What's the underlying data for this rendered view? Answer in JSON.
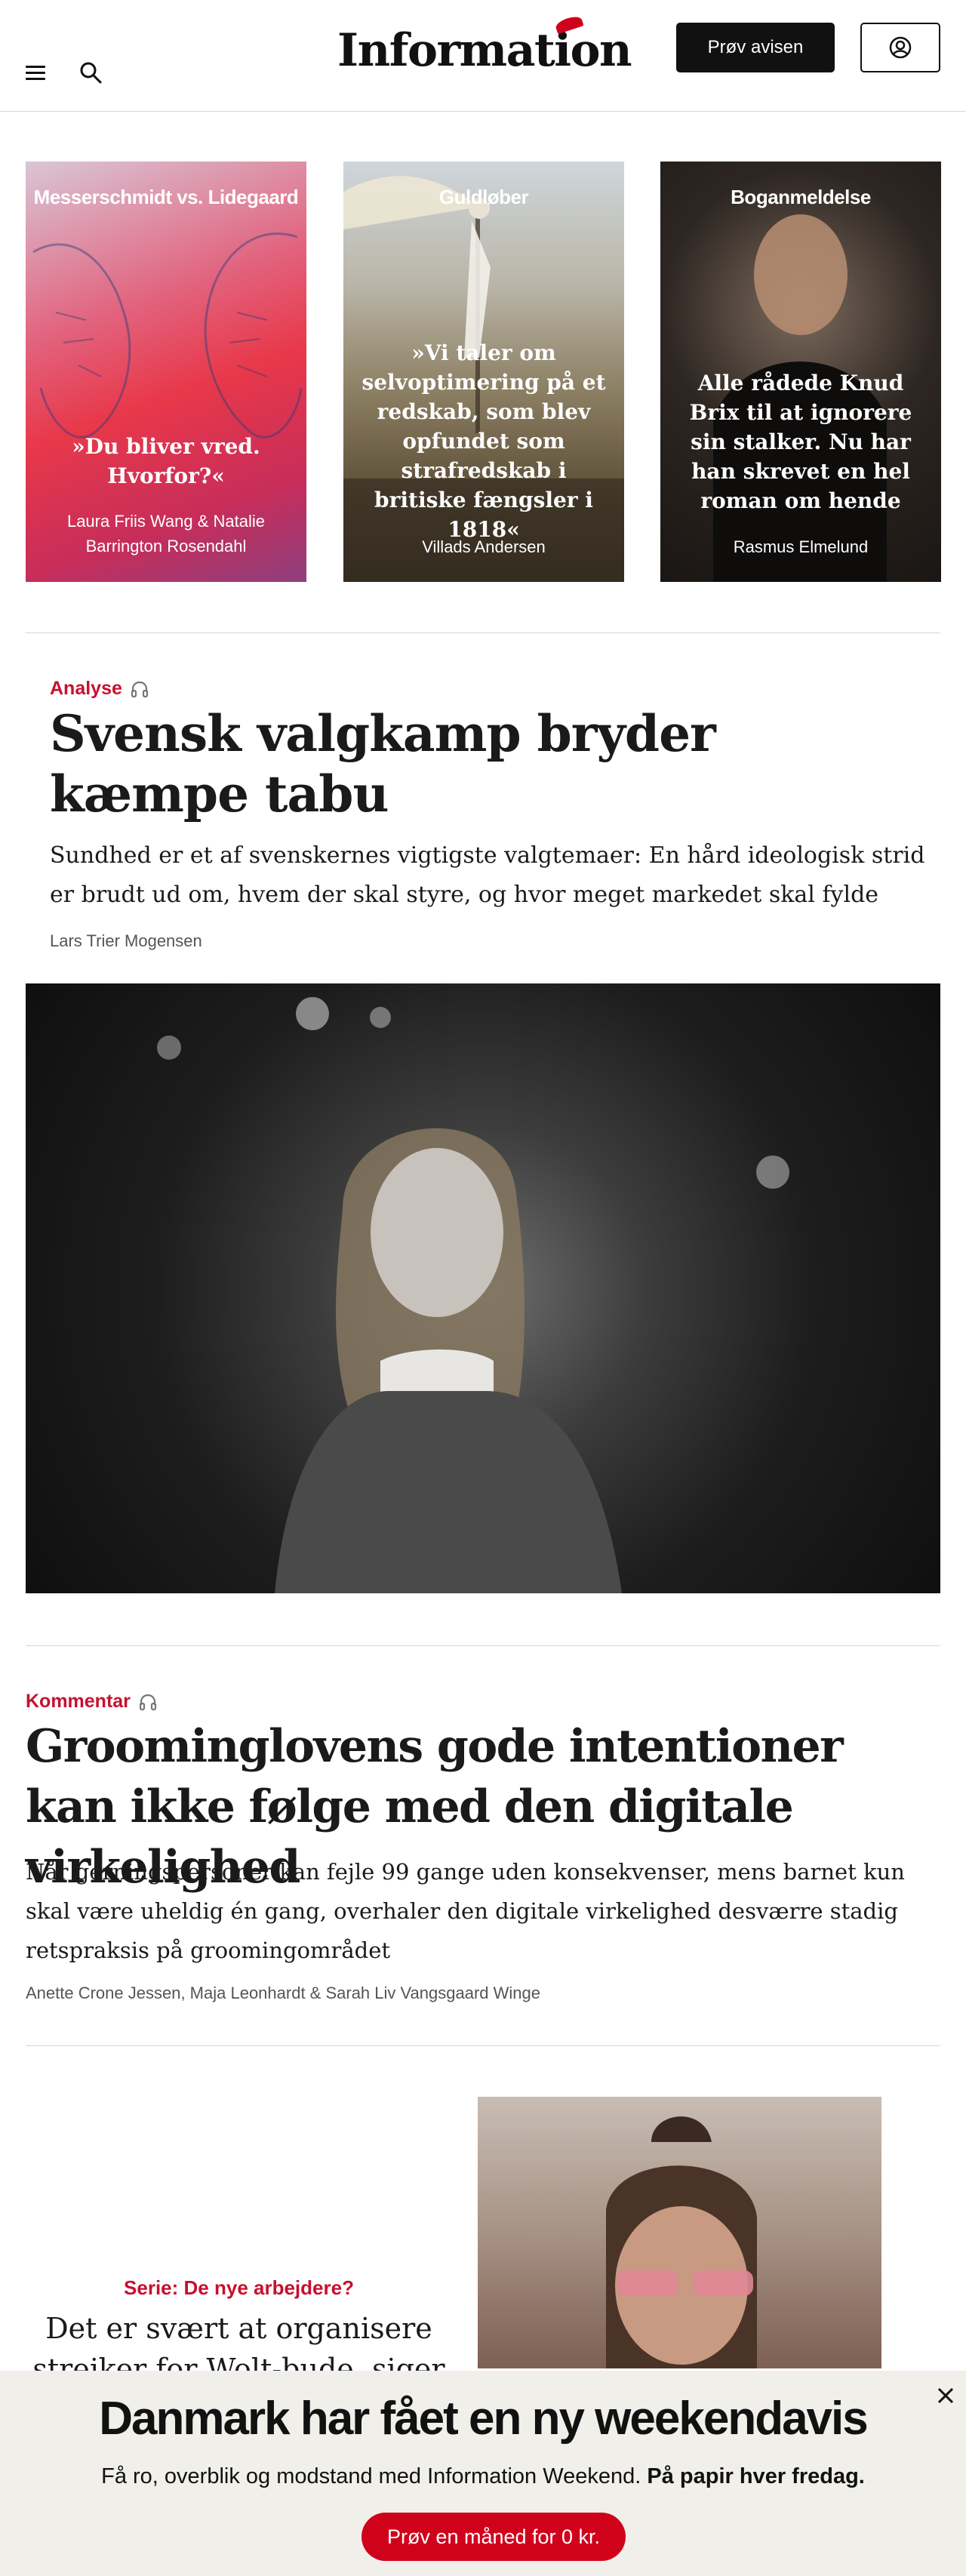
{
  "header": {
    "logo": "Information",
    "try_button": "Prøv avisen",
    "menu_icon": "hamburger-icon",
    "search_icon": "search-icon",
    "account_icon": "user-icon"
  },
  "cards": [
    {
      "kicker": "Messerschmidt vs. Lidegaard",
      "headline": "»Du bliver vred. Hvorfor?«",
      "byline": "Laura Friis Wang & Natalie Barrington Rosendahl"
    },
    {
      "kicker": "Guldløber",
      "headline": "»Vi taler om selvoptimering på et redskab, som blev opfundet som strafredskab i britiske fængsler i 1818«",
      "byline": "Villads Andersen"
    },
    {
      "kicker": "Boganmeldelse",
      "headline": "Alle rådede Knud Brix til at ignorere sin stalker. Nu har han skrevet en hel roman om hende",
      "byline": "Rasmus Elmelund"
    }
  ],
  "article1": {
    "kicker": "Analyse",
    "title": "Svensk valgkamp bryder kæmpe tabu",
    "lead": "Sundhed er et af svenskernes vigtigste valgtemaer: En hård ideologisk strid er brudt ud om, hvem der skal styre, og hvor meget markedet skal fylde",
    "byline": "Lars Trier Mogensen"
  },
  "article2": {
    "kicker": "Kommentar",
    "title": "Groominglovens gode intentioner kan ikke følge med den digitale virkelighed",
    "lead": "Når gerningspersoner kan fejle 99 gange uden konsekvenser, mens barnet kun skal være uheldig én gang, overhaler den digitale virkelighed desværre stadig retspraksis på groomingområdet",
    "byline": "Anette Crone Jessen, Maja Leonhardt & Sarah Liv Vangsgaard Winge"
  },
  "article3": {
    "kicker": "Serie: De nye arbejdere?",
    "title": "Det er svært at organisere strejker for Wolt-bude, siger"
  },
  "banner": {
    "title": "Danmark har fået en ny weekendavis",
    "text": "Få ro, overblik og modstand med Information Weekend.",
    "text_bold": "På papir hver fredag.",
    "button": "Prøv en måned for 0 kr.",
    "close_icon": "close-icon"
  },
  "colors": {
    "accent": "#c8102e",
    "banner_bg": "#f0efea",
    "button_dark": "#111111"
  }
}
